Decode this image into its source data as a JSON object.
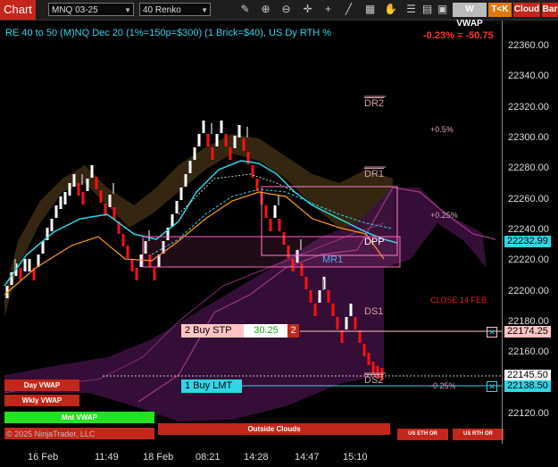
{
  "toolbar": {
    "chart_tab": "Chart",
    "instrument": "MNQ 03-25",
    "period": "40 Renko",
    "wvwap": "W VWAP",
    "tk": "T<K",
    "cloud": "Cloud",
    "bar": "Bar",
    "icons": [
      "pencil-icon",
      "zoom-in-icon",
      "zoom-out-icon",
      "crosshair-icon",
      "plus-icon",
      "dashed-line-icon",
      "grid-icon",
      "hand-icon",
      "checklist-icon",
      "table-icon",
      "tiles-icon"
    ]
  },
  "header": {
    "title": "RE 40 to 50 (M)NQ Dec 20 (1%=150p=$300) (1 Brick=$40), US Dy RTH %",
    "pct_change": "-0.23% = -50.75"
  },
  "yaxis": {
    "ticks": [
      "22360.00",
      "22340.00",
      "22320.00",
      "22300.00",
      "22280.00",
      "22260.00",
      "22240.00",
      "22220.00",
      "22200.00",
      "22180.00",
      "22160.00",
      "22140.00",
      "22120.00"
    ],
    "tick_values": [
      22360,
      22340,
      22320,
      22300,
      22280,
      22260,
      22240,
      22220,
      22200,
      22180,
      22160,
      22140,
      22120
    ],
    "labels": [
      {
        "text": "22232.99",
        "value": 22233,
        "bg": "#2fd6e6"
      },
      {
        "text": "22174.25",
        "value": 22174.25,
        "bg": "#ffc4c4"
      },
      {
        "text": "22145.50",
        "value": 22145.5,
        "bg": "#ffffff"
      },
      {
        "text": "22138.50",
        "value": 22138.5,
        "bg": "#2fd6e6"
      }
    ]
  },
  "levels": {
    "dr2": "DR2",
    "dr1": "DR1",
    "dpp": "DPP",
    "mr1": "MR1",
    "ds1": "DS1",
    "ds2": "DS2",
    "p05": "+0.5%",
    "p025": "+0.25%",
    "m025": "-0.25%",
    "close": "CLOSE 14 FEB"
  },
  "orders": {
    "buy_stp": "2 Buy STP",
    "buy_stp_price": "30.25",
    "buy_stp_qty": "2",
    "buy_lmt": "1 Buy LMT"
  },
  "panels": {
    "day_vwap": "Day VWAP",
    "wkly_vwap": "Wkly VWAP",
    "mnt_vwap": "Mnt VWAP",
    "outside_clouds": "Outside Clouds",
    "us_eth_or": "US ETH OR",
    "us_rth_or": "US RTH OR",
    "copyright": "© 2025 NinjaTrader, LLC"
  },
  "xaxis": [
    "16 Feb",
    "11:49",
    "18 Feb",
    "08:21",
    "14:28",
    "14:47",
    "15:10"
  ],
  "colors": {
    "accent": "#c3261a",
    "cyan": "#2fd6e6",
    "up": "#ffffff",
    "down": "#ff0000",
    "orange": "#ff9a1a"
  }
}
